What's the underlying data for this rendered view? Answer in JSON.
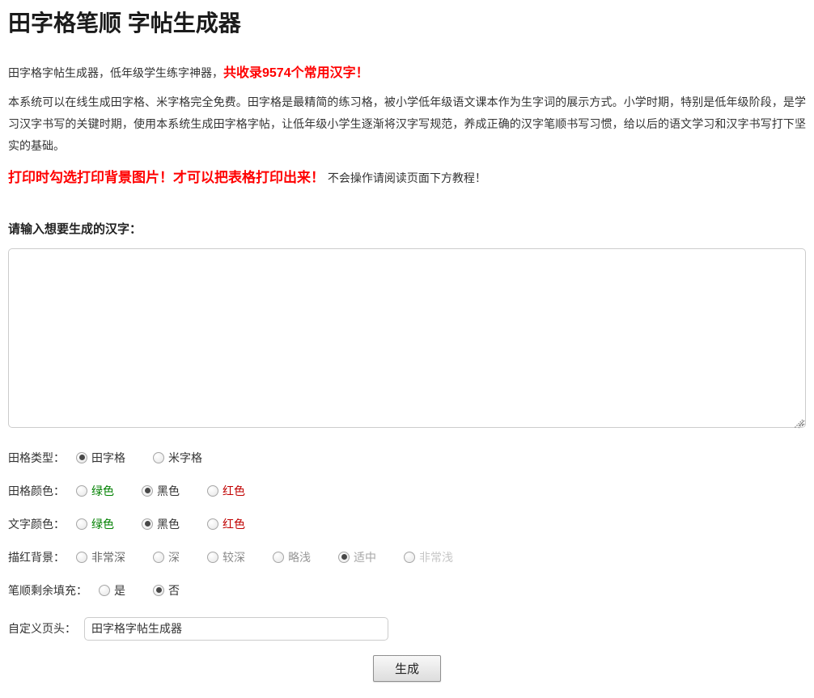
{
  "page_title": "田字格笔顺 字帖生成器",
  "intro": {
    "line1_text": "田字格字帖生成器，低年级学生练字神器，",
    "line1_highlight": "共收录9574个常用汉字！",
    "description": "本系统可以在线生成田字格、米字格完全免费。田字格是最精简的练习格，被小学低年级语文课本作为生字词的展示方式。小学时期，特别是低年级阶段，是学习汉字书写的关键时期，使用本系统生成田字格字帖，让低年级小学生逐渐将汉字写规范，养成正确的汉字笔顺书写习惯，给以后的语文学习和汉字书写打下坚实的基础。",
    "print_warning": "打印时勾选打印背景图片！才可以把表格打印出来！",
    "print_note": "不会操作请阅读页面下方教程！"
  },
  "form": {
    "input_label": "请输入想要生成的汉字：",
    "textarea": {
      "value": "",
      "placeholder": ""
    },
    "radio_groups": [
      {
        "name": "grid-type",
        "label": "田格类型：",
        "options": [
          {
            "label": "田字格",
            "selected": true
          },
          {
            "label": "米字格",
            "selected": false
          }
        ]
      },
      {
        "name": "grid-color",
        "label": "田格颜色：",
        "options": [
          {
            "label": "绿色",
            "selected": false,
            "color": "#008000"
          },
          {
            "label": "黑色",
            "selected": true,
            "color": "#333333"
          },
          {
            "label": "红色",
            "selected": false,
            "color": "#c00000"
          }
        ]
      },
      {
        "name": "text-color",
        "label": "文字颜色：",
        "options": [
          {
            "label": "绿色",
            "selected": false,
            "color": "#008000"
          },
          {
            "label": "黑色",
            "selected": true,
            "color": "#333333"
          },
          {
            "label": "红色",
            "selected": false,
            "color": "#c00000"
          }
        ]
      },
      {
        "name": "trace-background",
        "label": "描红背景：",
        "options": [
          {
            "label": "非常深",
            "selected": false,
            "color": "#666666"
          },
          {
            "label": "深",
            "selected": false,
            "color": "#7d7d7d"
          },
          {
            "label": "较深",
            "selected": false,
            "color": "#8a8a8a"
          },
          {
            "label": "略浅",
            "selected": false,
            "color": "#979797"
          },
          {
            "label": "适中",
            "selected": true,
            "color": "#a6a6a6"
          },
          {
            "label": "非常浅",
            "selected": false,
            "color": "#c6c6c6"
          }
        ]
      },
      {
        "name": "stroke-remaining-fill",
        "label": "笔顺剩余填充：",
        "options": [
          {
            "label": "是",
            "selected": false
          },
          {
            "label": "否",
            "selected": true
          }
        ]
      }
    ],
    "custom_header": {
      "label": "自定义页头：",
      "value": "田字格字帖生成器"
    },
    "generate_button_label": "生成"
  },
  "colors": {
    "highlight_red": "#ff0000",
    "option_green": "#008000",
    "option_red": "#c00000",
    "body_text": "#333333"
  }
}
